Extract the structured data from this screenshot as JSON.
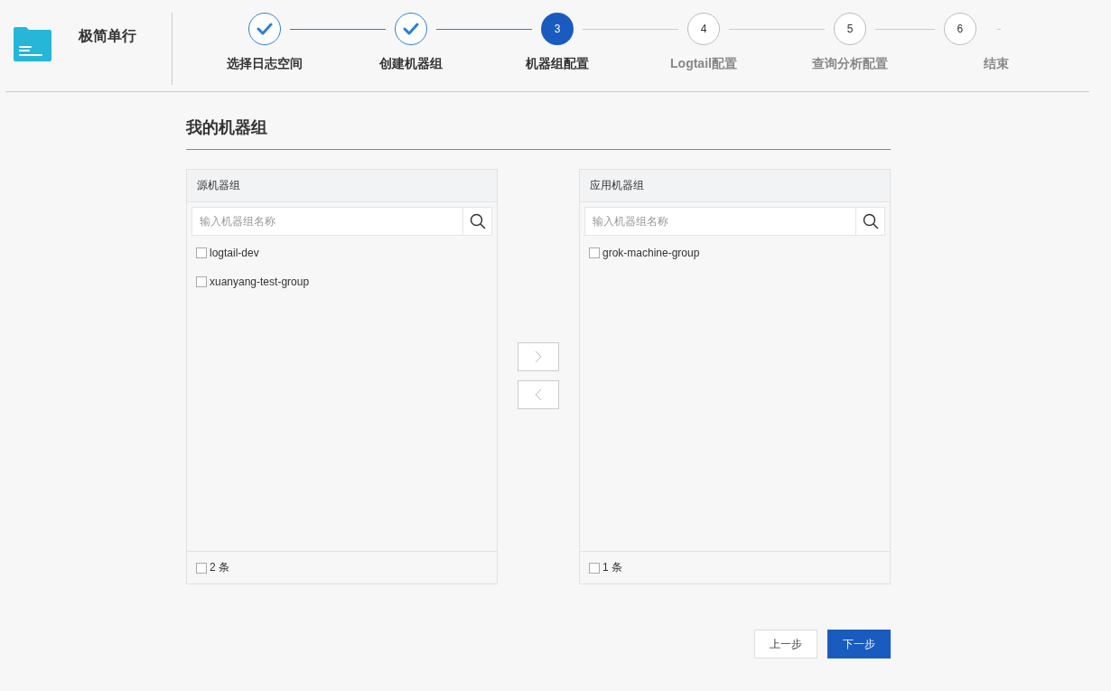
{
  "app": {
    "title": "极简单行"
  },
  "steps": [
    {
      "label": "选择日志空间",
      "done": true,
      "selected": false
    },
    {
      "label": "创建机器组",
      "done": true,
      "selected": false
    },
    {
      "label": "机器组配置",
      "done": false,
      "selected": true,
      "number": "3"
    },
    {
      "label": "Logtail配置",
      "done": false,
      "selected": false,
      "number": "4"
    },
    {
      "label": "查询分析配置",
      "done": false,
      "selected": false,
      "number": "5"
    },
    {
      "label": "结束",
      "done": false,
      "selected": false,
      "number": "6"
    }
  ],
  "section": {
    "title": "我的机器组"
  },
  "transfer": {
    "source": {
      "title": "源机器组",
      "placeholder": "输入机器组名称",
      "items": [
        {
          "label": "logtail-dev",
          "checked": false
        },
        {
          "label": "xuanyang-test-group",
          "checked": false
        }
      ],
      "footer": {
        "count": "2 条",
        "checked": false
      }
    },
    "target": {
      "title": "应用机器组",
      "placeholder": "输入机器组名称",
      "items": [
        {
          "label": "grok-machine-group",
          "checked": false
        }
      ],
      "footer": {
        "count": "1 条",
        "checked": false
      }
    }
  },
  "buttons": [
    {
      "label": "上一步",
      "kind": "secondary"
    },
    {
      "label": "下一步",
      "kind": "primary"
    }
  ]
}
